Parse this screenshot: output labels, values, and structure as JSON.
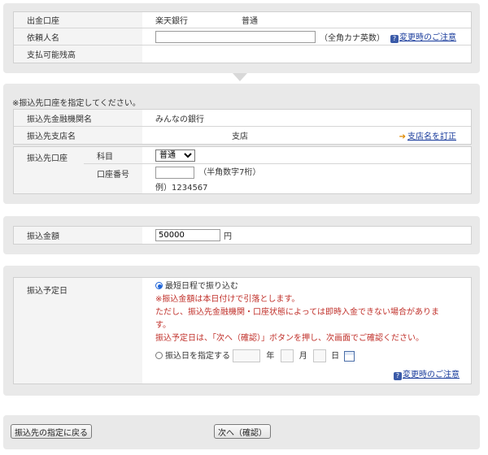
{
  "source": {
    "account_label": "出金口座",
    "bank_name": "楽天銀行",
    "account_type": "普通",
    "requester_label": "依頼人名",
    "requester_value": "",
    "requester_hint": "（全角カナ英数）",
    "change_notice": "変更時のご注意",
    "balance_label": "支払可能残高",
    "balance_value": ""
  },
  "dest": {
    "instruction": "※振込先口座を指定してください。",
    "bank_label": "振込先金融機関名",
    "bank_value": "みんなの銀行",
    "branch_label": "振込先支店名",
    "branch_value": "支店",
    "branch_fix_link": "支店名を訂正",
    "account_label": "振込先口座",
    "subject_label": "科目",
    "subject_selected": "普通",
    "number_label": "口座番号",
    "number_value": "",
    "number_hint": "（半角数字7桁）",
    "number_example": "例）1234567"
  },
  "amount": {
    "label": "振込金額",
    "value": "50000",
    "unit": "円"
  },
  "schedule": {
    "label": "振込予定日",
    "option_earliest": "最短日程で振り込む",
    "note_line1": "※振込金額は本日付けで引落とします。",
    "note_line2": "ただし、振込先金融機関・口座状態によっては即時入金できない場合がありま",
    "note_line3": "す。",
    "note_line4": "振込予定日は、「次へ（確認）」ボタンを押し、次画面でご確認ください。",
    "option_specify": "振込日を指定する",
    "year_unit": "年",
    "month_unit": "月",
    "day_unit": "日",
    "change_notice": "変更時のご注意"
  },
  "buttons": {
    "back": "振込先の指定に戻る",
    "next": "次へ（確認）"
  }
}
